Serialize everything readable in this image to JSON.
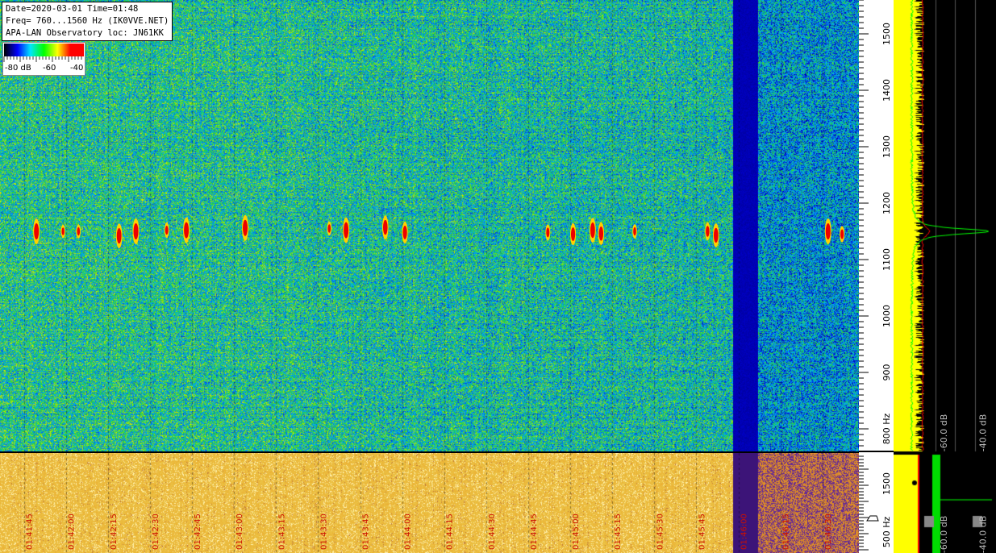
{
  "info": {
    "line1": "Date=2020-03-01 Time=01:48",
    "line2": "Freq= 760...1560 Hz (IK0VVE.NET)",
    "line3": "APA-LAN Observatory loc: JN61KK"
  },
  "legend": {
    "labels": [
      "-80 dB",
      "-60",
      "-40"
    ],
    "colors": [
      "#000000",
      "#0000ff",
      "#00e5ff",
      "#00ff00",
      "#ffff00",
      "#ff0000",
      "#ff0000"
    ]
  },
  "chart_data": {
    "type": "heatmap",
    "title": "",
    "freq_range_hz": [
      760,
      1560
    ],
    "y_ticks": [
      "1500",
      "1400",
      "1300",
      "1200",
      "1100",
      "1000",
      "900",
      "800 Hz"
    ],
    "y_tick_values": [
      1500,
      1400,
      1300,
      1200,
      1100,
      1000,
      900,
      800
    ],
    "lower_y_ticks": [
      "1500",
      "500 Hz"
    ],
    "lower_y_tick_values": [
      1500,
      500
    ],
    "time_labels": [
      "01:41:45",
      "01:42:00",
      "01:42:15",
      "01:42:30",
      "01:42:45",
      "01:43:00",
      "01:43:15",
      "01:43:30",
      "01:43:45",
      "01:44:00",
      "01:44:15",
      "01:44:30",
      "01:44:45",
      "01:45:00",
      "01:45:15",
      "01:45:30",
      "01:45:45",
      "01:46:00",
      "01:46:15",
      "01:46:30"
    ],
    "time_label_values_s": [
      0,
      15,
      30,
      45,
      60,
      75,
      90,
      105,
      120,
      135,
      150,
      165,
      180,
      195,
      210,
      225,
      240,
      255,
      270,
      285
    ],
    "time_range_s": [
      -8.5,
      298
    ],
    "gap": {
      "start_s": 253,
      "end_s": 262
    },
    "signal_freq_hz": 1150,
    "pings": [
      {
        "t": 4.5,
        "f": 1150,
        "strength": 1.0
      },
      {
        "t": 14,
        "f": 1150,
        "strength": 0.35
      },
      {
        "t": 19.5,
        "f": 1150,
        "strength": 0.4
      },
      {
        "t": 34,
        "f": 1142,
        "strength": 0.95
      },
      {
        "t": 40,
        "f": 1150,
        "strength": 1.0
      },
      {
        "t": 51,
        "f": 1152,
        "strength": 0.45
      },
      {
        "t": 58,
        "f": 1152,
        "strength": 1.0
      },
      {
        "t": 79,
        "f": 1156,
        "strength": 1.0
      },
      {
        "t": 109,
        "f": 1155,
        "strength": 0.4
      },
      {
        "t": 115,
        "f": 1152,
        "strength": 1.0
      },
      {
        "t": 129,
        "f": 1157,
        "strength": 0.9
      },
      {
        "t": 136,
        "f": 1148,
        "strength": 0.8
      },
      {
        "t": 187,
        "f": 1148,
        "strength": 0.5
      },
      {
        "t": 196,
        "f": 1145,
        "strength": 0.8
      },
      {
        "t": 203,
        "f": 1152,
        "strength": 0.95
      },
      {
        "t": 206,
        "f": 1146,
        "strength": 0.85
      },
      {
        "t": 218,
        "f": 1150,
        "strength": 0.4
      },
      {
        "t": 244,
        "f": 1150,
        "strength": 0.6
      },
      {
        "t": 247,
        "f": 1143,
        "strength": 0.9
      },
      {
        "t": 287,
        "f": 1150,
        "strength": 1.0
      },
      {
        "t": 292,
        "f": 1145,
        "strength": 0.5
      }
    ],
    "spectrum_ticks": [
      "-60.0 dB",
      "-40.0 dB"
    ],
    "spectrum_tick_values_db": [
      -60,
      -40
    ],
    "spectrum_range_db": [
      -80,
      -30
    ],
    "spectrum_peak": {
      "f": 1150,
      "db": -33
    }
  }
}
